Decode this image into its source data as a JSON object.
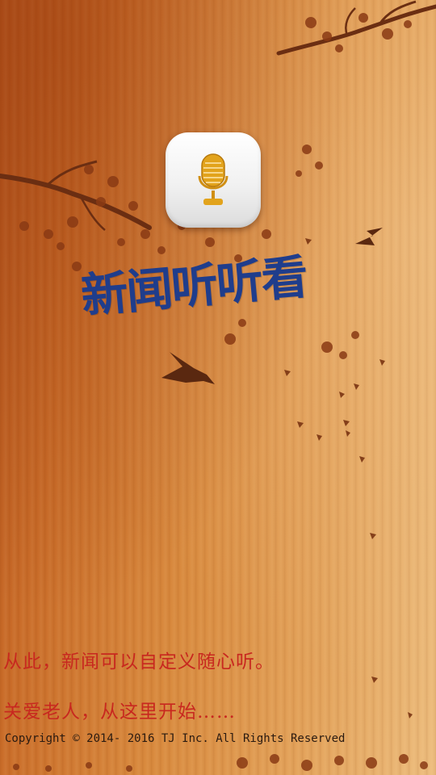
{
  "app": {
    "title": "新闻听听看",
    "icon": "microphone-icon"
  },
  "slogans": {
    "line1": "从此，新闻可以自定义随心听。",
    "line2": "关爱老人，从这里开始……"
  },
  "footer": {
    "copyright": "Copyright © 2014- 2016 TJ Inc. All Rights Reserved"
  },
  "colors": {
    "title": "#1f3d8c",
    "slogan": "#c8281f",
    "icon_accent": "#e0a21a"
  }
}
